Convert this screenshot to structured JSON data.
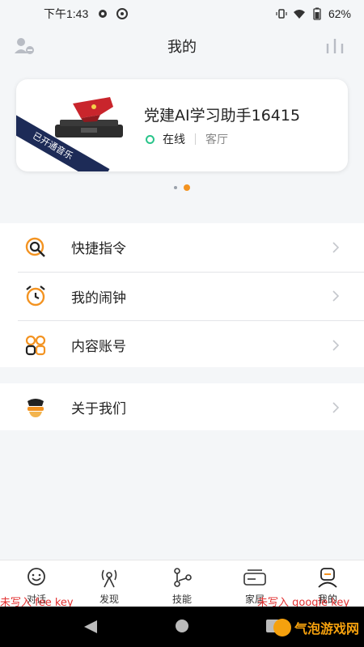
{
  "status_bar": {
    "time": "下午1:43",
    "battery": "62%"
  },
  "header": {
    "title": "我的"
  },
  "device_card": {
    "name": "党建AI学习助手16415",
    "status": "在线",
    "room": "客厅",
    "ribbon": "已开通音乐"
  },
  "pager": {
    "count": 2,
    "active_index": 1
  },
  "menu_group_1": [
    {
      "label": "快捷指令",
      "icon": "shortcut-icon"
    },
    {
      "label": "我的闹钟",
      "icon": "alarm-clock-icon"
    },
    {
      "label": "内容账号",
      "icon": "content-account-icon"
    }
  ],
  "menu_group_2": [
    {
      "label": "关于我们",
      "icon": "about-us-icon"
    }
  ],
  "tabs": [
    {
      "label": "对话",
      "icon": "chat-icon"
    },
    {
      "label": "发现",
      "icon": "discover-icon"
    },
    {
      "label": "技能",
      "icon": "skill-icon"
    },
    {
      "label": "家居",
      "icon": "home-device-icon"
    },
    {
      "label": "我的",
      "icon": "profile-icon",
      "active": true
    }
  ],
  "overlay": {
    "left": "未写入 fee key",
    "right": "未写入 google key"
  },
  "watermark": {
    "text": "气泡游戏网"
  },
  "colors": {
    "accent": "#f39321",
    "online": "#29c48a",
    "ribbon": "#1d2b57",
    "warning_text": "#e23030"
  }
}
